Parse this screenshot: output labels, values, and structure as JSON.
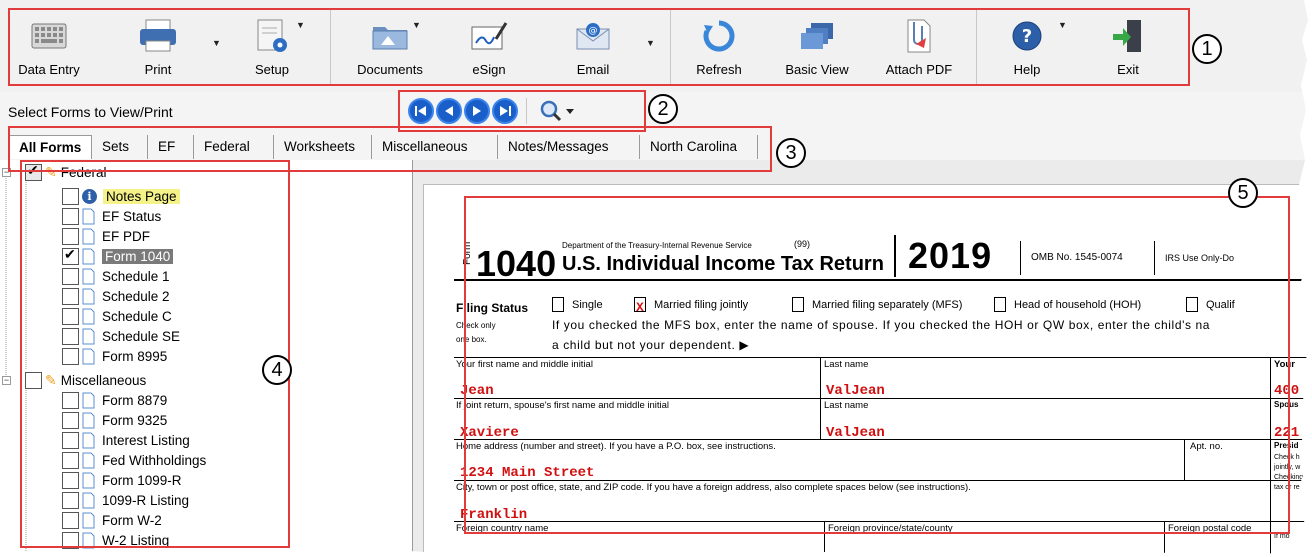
{
  "toolbar": {
    "buttons": [
      {
        "label": "Data Entry",
        "icon": "keyboard-icon"
      },
      {
        "label": "Print",
        "icon": "printer-icon"
      },
      {
        "label": "Setup",
        "icon": "setup-icon"
      },
      {
        "label": "Documents",
        "icon": "folder-icon"
      },
      {
        "label": "eSign",
        "icon": "esign-icon"
      },
      {
        "label": "Email",
        "icon": "email-icon"
      },
      {
        "label": "Refresh",
        "icon": "refresh-icon"
      },
      {
        "label": "Basic View",
        "icon": "basic-view-icon"
      },
      {
        "label": "Attach PDF",
        "icon": "attach-pdf-icon"
      },
      {
        "label": "Help",
        "icon": "help-icon"
      },
      {
        "label": "Exit",
        "icon": "exit-icon"
      }
    ]
  },
  "navrow": {
    "title": "Select Forms to View/Print",
    "buttons": [
      "first-page-icon",
      "previous-page-icon",
      "next-page-icon",
      "last-page-icon"
    ],
    "zoom_icon": "magnifier-icon"
  },
  "tabs": [
    "All Forms",
    "Sets",
    "EF",
    "Federal",
    "Worksheets",
    "Miscellaneous",
    "Notes/Messages",
    "North Carolina"
  ],
  "tree": {
    "federal_label": "Federal",
    "federal_items": [
      "Notes Page",
      "EF Status",
      "EF PDF",
      "Form 1040",
      "Schedule 1",
      "Schedule 2",
      "Schedule C",
      "Schedule SE",
      "Form 8995"
    ],
    "misc_label": "Miscellaneous",
    "misc_items": [
      "Form 8879",
      "Form 9325",
      "Interest Listing",
      "Fed Withholdings",
      "Form 1099-R",
      "1099-R Listing",
      "Form W-2",
      "W-2 Listing"
    ]
  },
  "form": {
    "form_word": "Form",
    "number": "1040",
    "dept": "Department of the Treasury-Internal Revenue Service",
    "code": "(99)",
    "title": "U.S. Individual Income Tax Return",
    "year": "2019",
    "omb": "OMB No. 1545-0074",
    "irs_use": "IRS Use Only-Do",
    "filing_status_label": "Filing Status",
    "filing_status_sub": "Check only one box.",
    "options": [
      "Single",
      "Married filing jointly",
      "Married filing separately (MFS)",
      "Head of household (HOH)",
      "Qualif"
    ],
    "checked_mark": "X",
    "note_line1": "If you checked the MFS box, enter the name of spouse. If you checked the HOH or QW box, enter the child's na",
    "note_line2": "a child but not your dependent. ▶",
    "first_name_label": "Your first name and middle initial",
    "last_name_label": "Last name",
    "your_ssn_label": "Your",
    "first_name": "Jean",
    "last_name": "ValJean",
    "ssn_partial": "400",
    "spouse_label": "If joint return, spouse's first name and middle initial",
    "spouse_last_label": "Last name",
    "spouse_ssn_label": "Spous",
    "spouse_first": "Xaviere",
    "spouse_last": "ValJean",
    "spouse_ssn_partial": "221",
    "address_label": "Home address (number and street). If you have a P.O. box, see instructions.",
    "apt_label": "Apt. no.",
    "presid_label": "Presid",
    "address": "1234 Main Street",
    "city_label": "City, town or post office, state, and ZIP code. If you have a foreign address, also complete spaces below (see instructions).",
    "city": "Franklin",
    "foreign_country_label": "Foreign country name",
    "foreign_province_label": "Foreign province/state/county",
    "foreign_postal_label": "Foreign postal code",
    "side_notes": [
      "Check h",
      "jointly, w",
      "Checking",
      "tax or re",
      "If mo"
    ]
  },
  "callouts": [
    "1",
    "2",
    "3",
    "4",
    "5"
  ],
  "colors": {
    "callout": "#e23b3b",
    "nav_blue": "#1a5fc9",
    "filled_value": "#d01010"
  }
}
